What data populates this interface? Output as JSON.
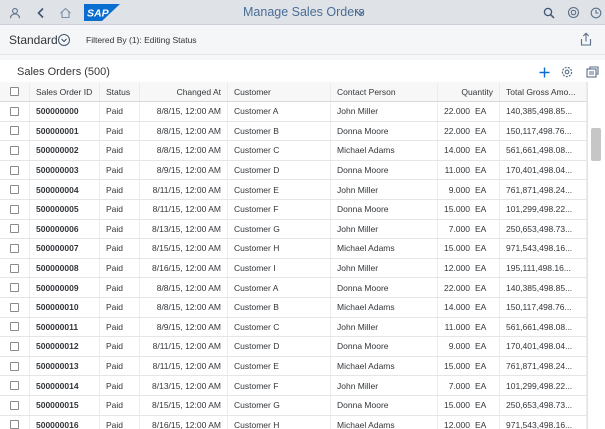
{
  "shell": {
    "title": "Manage Sales Orders",
    "logo_text": "SAP",
    "brand_color": "#0a6ed1",
    "icons": [
      "user-icon",
      "back-icon",
      "home-icon",
      "search-icon",
      "notifications-icon",
      "product-switch-icon"
    ]
  },
  "subheader": {
    "variant": "Standard",
    "filtered_by": "Filtered By (1): Editing Status"
  },
  "table": {
    "title": "Sales Orders (500)",
    "columns": {
      "id": "Sales Order ID",
      "status": "Status",
      "changed": "Changed At",
      "customer": "Customer",
      "contact": "Contact Person",
      "quantity": "Quantity",
      "gross": "Total Gross Amo..."
    },
    "rows": [
      {
        "id": "500000000",
        "status": "Paid",
        "changed": "8/8/15, 12:00 AM",
        "customer": "Customer A",
        "contact": "John Miller",
        "qty": "22.000",
        "unit": "EA",
        "gross": "140,385,498.85..."
      },
      {
        "id": "500000001",
        "status": "Paid",
        "changed": "8/8/15, 12:00 AM",
        "customer": "Customer B",
        "contact": "Donna Moore",
        "qty": "22.000",
        "unit": "EA",
        "gross": "150,117,498.76..."
      },
      {
        "id": "500000002",
        "status": "Paid",
        "changed": "8/8/15, 12:00 AM",
        "customer": "Customer C",
        "contact": "Michael Adams",
        "qty": "14.000",
        "unit": "EA",
        "gross": "561,661,498.08..."
      },
      {
        "id": "500000003",
        "status": "Paid",
        "changed": "8/9/15, 12:00 AM",
        "customer": "Customer D",
        "contact": "Donna Moore",
        "qty": "11.000",
        "unit": "EA",
        "gross": "170,401,498.04..."
      },
      {
        "id": "500000004",
        "status": "Paid",
        "changed": "8/11/15, 12:00 AM",
        "customer": "Customer E",
        "contact": "John Miller",
        "qty": "9.000",
        "unit": "EA",
        "gross": "761,871,498.24..."
      },
      {
        "id": "500000005",
        "status": "Paid",
        "changed": "8/11/15, 12:00 AM",
        "customer": "Customer F",
        "contact": "Donna Moore",
        "qty": "15.000",
        "unit": "EA",
        "gross": "101,299,498.22..."
      },
      {
        "id": "500000006",
        "status": "Paid",
        "changed": "8/13/15, 12:00 AM",
        "customer": "Customer G",
        "contact": "John Miller",
        "qty": "7.000",
        "unit": "EA",
        "gross": "250,653,498.73..."
      },
      {
        "id": "500000007",
        "status": "Paid",
        "changed": "8/15/15, 12:00 AM",
        "customer": "Customer H",
        "contact": "Michael Adams",
        "qty": "15.000",
        "unit": "EA",
        "gross": "971,543,498.16..."
      },
      {
        "id": "500000008",
        "status": "Paid",
        "changed": "8/16/15, 12:00 AM",
        "customer": "Customer I",
        "contact": "John Miller",
        "qty": "12.000",
        "unit": "EA",
        "gross": "195,111,498.16..."
      },
      {
        "id": "500000009",
        "status": "Paid",
        "changed": "8/8/15, 12:00 AM",
        "customer": "Customer A",
        "contact": "Donna Moore",
        "qty": "22.000",
        "unit": "EA",
        "gross": "140,385,498.85..."
      },
      {
        "id": "500000010",
        "status": "Paid",
        "changed": "8/8/15, 12:00 AM",
        "customer": "Customer B",
        "contact": "Michael Adams",
        "qty": "14.000",
        "unit": "EA",
        "gross": "150,117,498.76..."
      },
      {
        "id": "500000011",
        "status": "Paid",
        "changed": "8/9/15, 12:00 AM",
        "customer": "Customer C",
        "contact": "John Miller",
        "qty": "11.000",
        "unit": "EA",
        "gross": "561,661,498.08..."
      },
      {
        "id": "500000012",
        "status": "Paid",
        "changed": "8/11/15, 12:00 AM",
        "customer": "Customer D",
        "contact": "Donna Moore",
        "qty": "9.000",
        "unit": "EA",
        "gross": "170,401,498.04..."
      },
      {
        "id": "500000013",
        "status": "Paid",
        "changed": "8/11/15, 12:00 AM",
        "customer": "Customer E",
        "contact": "Michael Adams",
        "qty": "15.000",
        "unit": "EA",
        "gross": "761,871,498.24..."
      },
      {
        "id": "500000014",
        "status": "Paid",
        "changed": "8/13/15, 12:00 AM",
        "customer": "Customer F",
        "contact": "John Miller",
        "qty": "7.000",
        "unit": "EA",
        "gross": "101,299,498.22..."
      },
      {
        "id": "500000015",
        "status": "Paid",
        "changed": "8/15/15, 12:00 AM",
        "customer": "Customer G",
        "contact": "Donna Moore",
        "qty": "15.000",
        "unit": "EA",
        "gross": "250,653,498.73..."
      },
      {
        "id": "500000016",
        "status": "Paid",
        "changed": "8/16/15, 12:00 AM",
        "customer": "Customer H",
        "contact": "Michael Adams",
        "qty": "12.000",
        "unit": "EA",
        "gross": "971,543,498.16..."
      }
    ]
  }
}
